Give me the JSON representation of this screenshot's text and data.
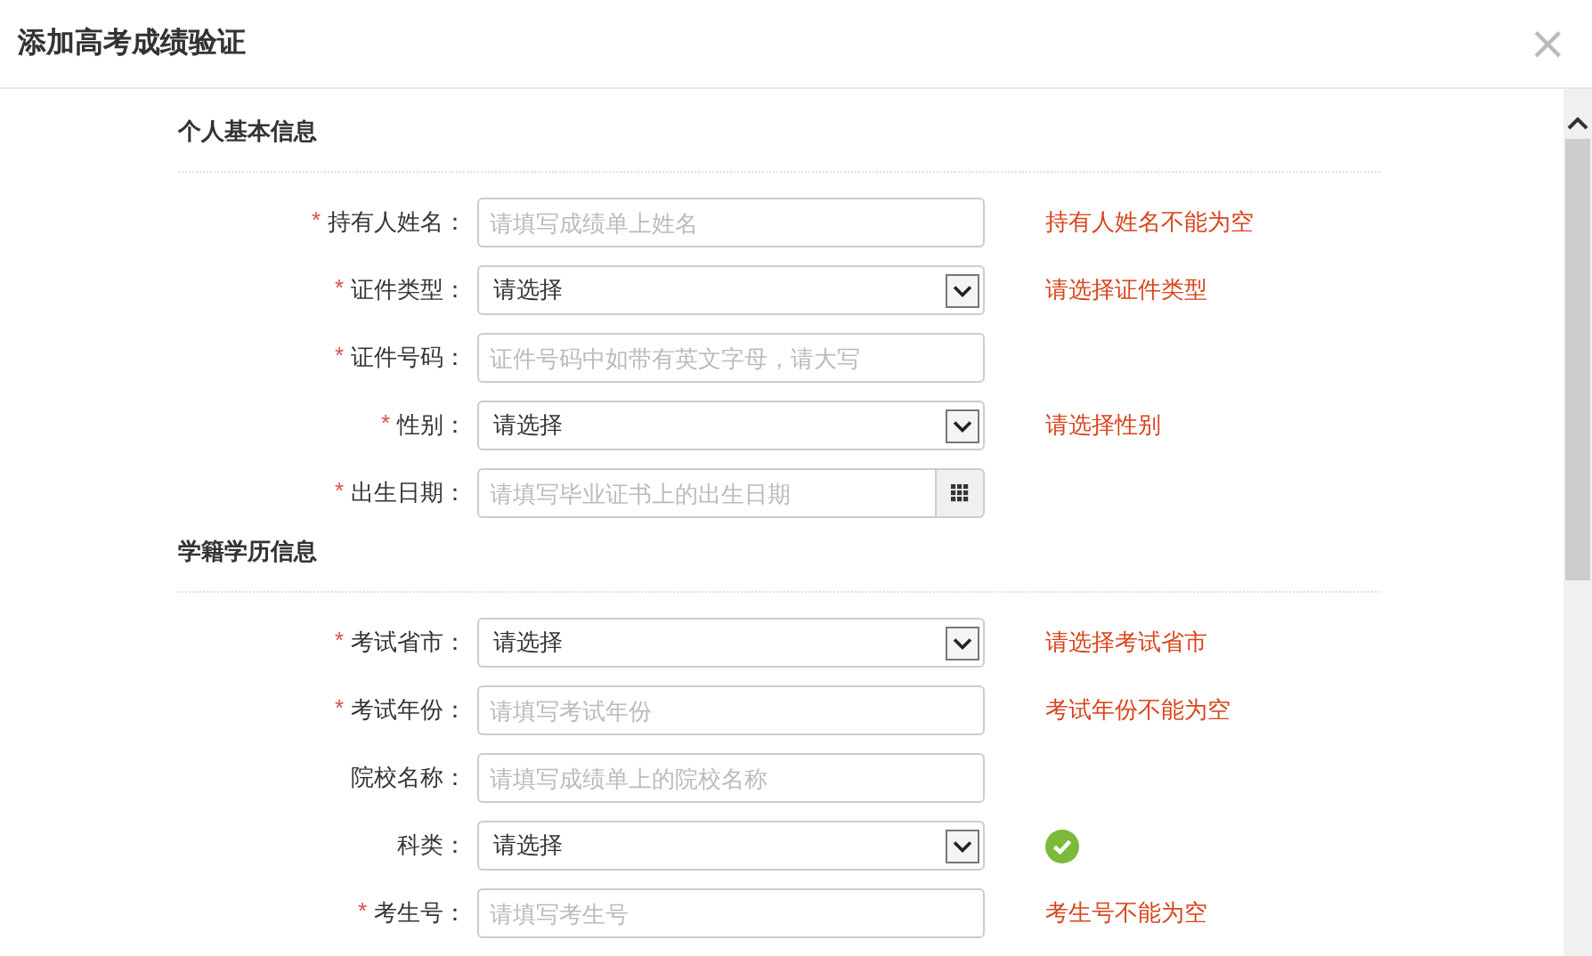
{
  "dialog": {
    "title": "添加高考成绩验证",
    "close": "×"
  },
  "sections": [
    {
      "title": "个人基本信息",
      "fields": [
        {
          "required_mark": "*",
          "label": "持有人姓名：",
          "kind": "text",
          "placeholder": "请填写成绩单上姓名",
          "message": {
            "kind": "error",
            "text": "持有人姓名不能为空"
          }
        },
        {
          "required_mark": "*",
          "label": "证件类型：",
          "kind": "select",
          "value": "请选择",
          "message": {
            "kind": "error",
            "text": "请选择证件类型"
          }
        },
        {
          "required_mark": "*",
          "label": "证件号码：",
          "kind": "text",
          "placeholder": "证件号码中如带有英文字母，请大写"
        },
        {
          "required_mark": "*",
          "label": "性别：",
          "kind": "select",
          "value": "请选择",
          "message": {
            "kind": "error",
            "text": "请选择性别"
          }
        },
        {
          "required_mark": "*",
          "label": "出生日期：",
          "kind": "date",
          "placeholder": "请填写毕业证书上的出生日期"
        }
      ]
    },
    {
      "title": "学籍学历信息",
      "fields": [
        {
          "required_mark": "*",
          "label": "考试省市：",
          "kind": "select",
          "value": "请选择",
          "message": {
            "kind": "error",
            "text": "请选择考试省市"
          }
        },
        {
          "required_mark": "*",
          "label": "考试年份：",
          "kind": "text",
          "placeholder": "请填写考试年份",
          "message": {
            "kind": "error",
            "text": "考试年份不能为空"
          }
        },
        {
          "label": "院校名称：",
          "kind": "text",
          "placeholder": "请填写成绩单上的院校名称"
        },
        {
          "label": "科类：",
          "kind": "select",
          "value": "请选择",
          "message": {
            "kind": "ok"
          }
        },
        {
          "required_mark": "*",
          "label": "考生号：",
          "kind": "text",
          "placeholder": "请填写考生号",
          "message": {
            "kind": "error",
            "text": "考生号不能为空"
          }
        }
      ]
    }
  ]
}
